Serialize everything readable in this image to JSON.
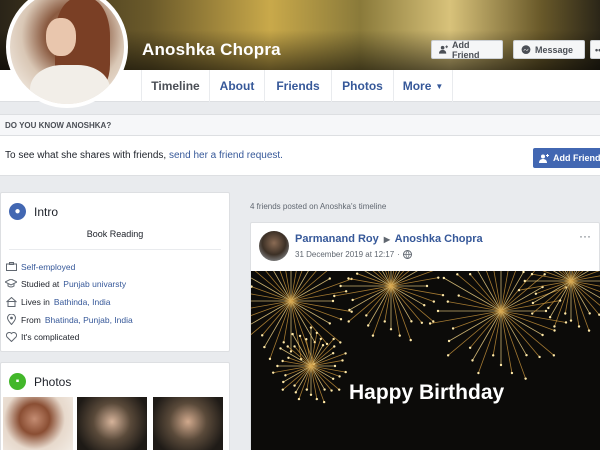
{
  "profile": {
    "name": "Anoshka Chopra",
    "add_friend_label": "Add Friend",
    "message_label": "Message",
    "more_dots": "•••"
  },
  "tabs": [
    {
      "label": "Timeline",
      "active": true
    },
    {
      "label": "About"
    },
    {
      "label": "Friends"
    },
    {
      "label": "Photos"
    },
    {
      "label": "More"
    }
  ],
  "know": {
    "heading": "DO YOU KNOW ANOSHKA?",
    "text": "To see what she shares with friends, ",
    "link": "send her a friend request.",
    "button_label": "Add Friend"
  },
  "intro": {
    "title": "Intro",
    "bio": "Book Reading",
    "rows": [
      {
        "icon": "briefcase-icon",
        "prefix": "",
        "link": "Self-employed"
      },
      {
        "icon": "graduation-cap-icon",
        "prefix": "Studied at ",
        "link": "Punjab univarsty"
      },
      {
        "icon": "house-icon",
        "prefix": "Lives in ",
        "link": "Bathinda, India"
      },
      {
        "icon": "location-pin-icon",
        "prefix": "From ",
        "link": "Bhatinda, Punjab, India"
      },
      {
        "icon": "heart-icon",
        "prefix": "It's complicated",
        "link": ""
      }
    ]
  },
  "photos": {
    "title": "Photos"
  },
  "feed": {
    "posted_count": "4 friends posted on Anoshka's timeline",
    "post": {
      "author": "Parmanand Roy",
      "arrow": "▶",
      "target": "Anoshka Chopra",
      "time": "31 December 2019 at 12:17",
      "audience_sep": "·",
      "menu": "···",
      "image_text": "Happy Birthday"
    }
  },
  "colors": {
    "link": "#365899",
    "primary_button": "#4267b2",
    "intro_icon": "#4267b2",
    "photos_icon": "#42b72a"
  }
}
